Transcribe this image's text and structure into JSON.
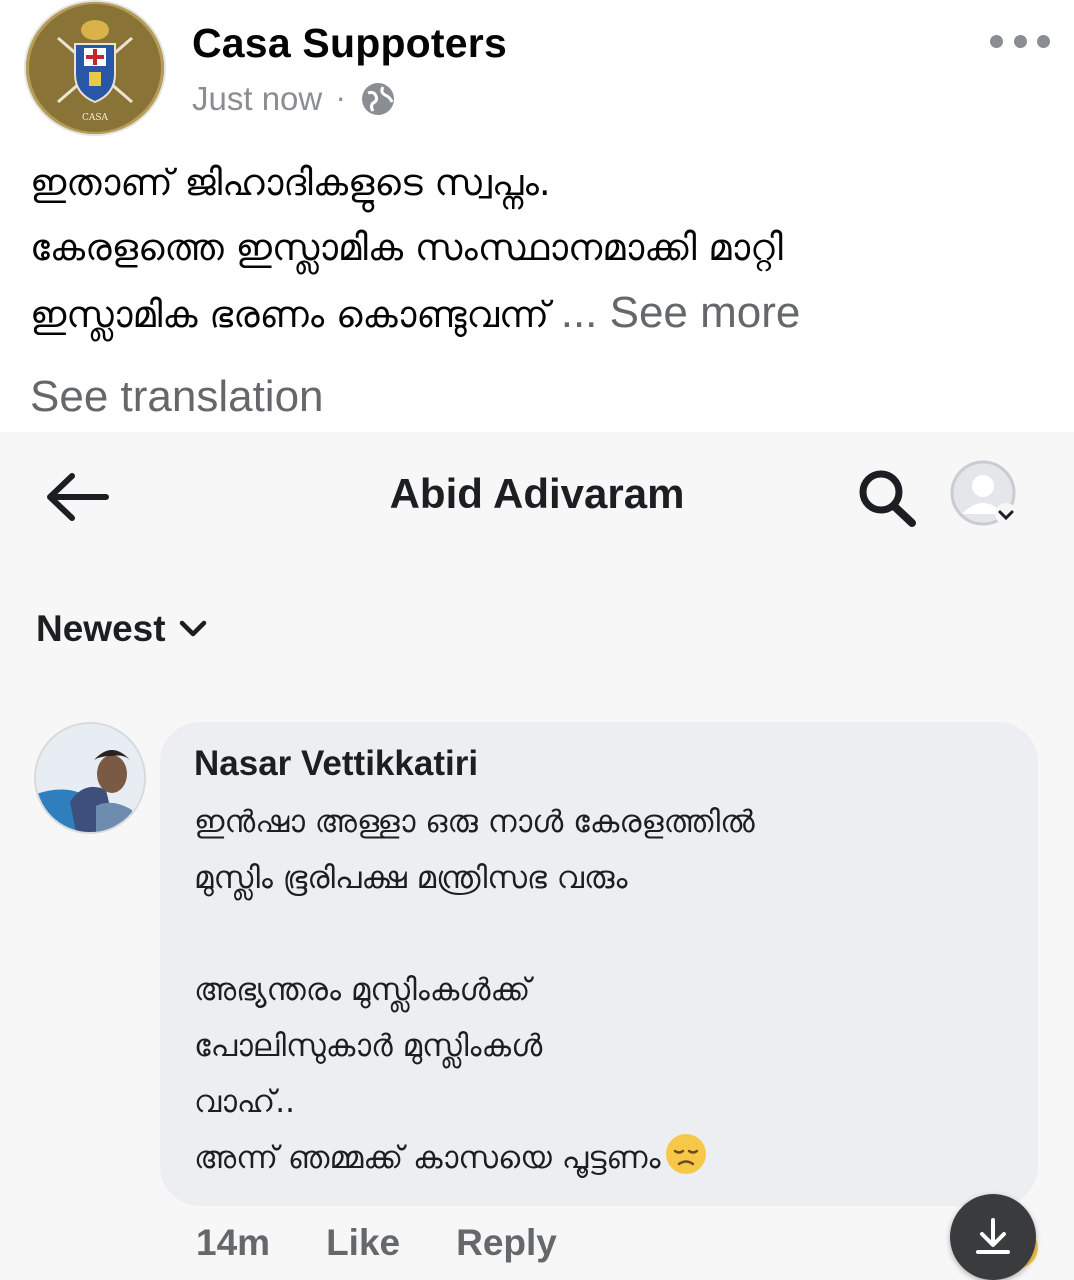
{
  "post": {
    "author": "Casa Suppoters",
    "avatar_text": "CASA",
    "time": "Just now",
    "separator": "·",
    "text_lines": [
      "ഇതാണ് ജിഹാദികളുടെ സ്വപ്നം.",
      "കേരളത്തെ ഇസ്ലാമിക സംസ്ഥാനമാക്കി മാറ്റി",
      "ഇസ്ലാമിക ഭരണം കൊണ്ടുവന്ന്"
    ],
    "see_more": "... See more",
    "see_translation": "See translation"
  },
  "screenshot": {
    "title": "Abid Adivaram",
    "sort_label": "Newest",
    "comment": {
      "author": "Nasar Vettikkatiri",
      "lines": [
        "ഇൻഷാ അള്ളാ ഒരു നാൾ കേരളത്തിൽ",
        "മുസ്ലിം ഭൂരിപക്ഷ മന്ത്രിസഭ വരും",
        "",
        "അഭ്യന്തരം മുസ്ലിംകൾക്ക്",
        "പോലിസുകാർ മുസ്ലിംകൾ",
        "വാഹ്..",
        "അന്ന് ഞമ്മക്ക് കാസയെ പൂട്ടണം"
      ],
      "time": "14m",
      "like_label": "Like",
      "reply_label": "Reply"
    }
  },
  "icons": {
    "more": "more-horizontal-icon",
    "globe": "globe-icon",
    "back": "arrow-left-icon",
    "search": "search-icon",
    "profile": "profile-icon",
    "chevron": "chevron-down-icon",
    "emoji": "sad-emoji-icon",
    "download": "download-icon"
  },
  "colors": {
    "secondary_text": "#65676b",
    "bubble": "#eceef1",
    "avatar_gold": "#8a7336"
  }
}
